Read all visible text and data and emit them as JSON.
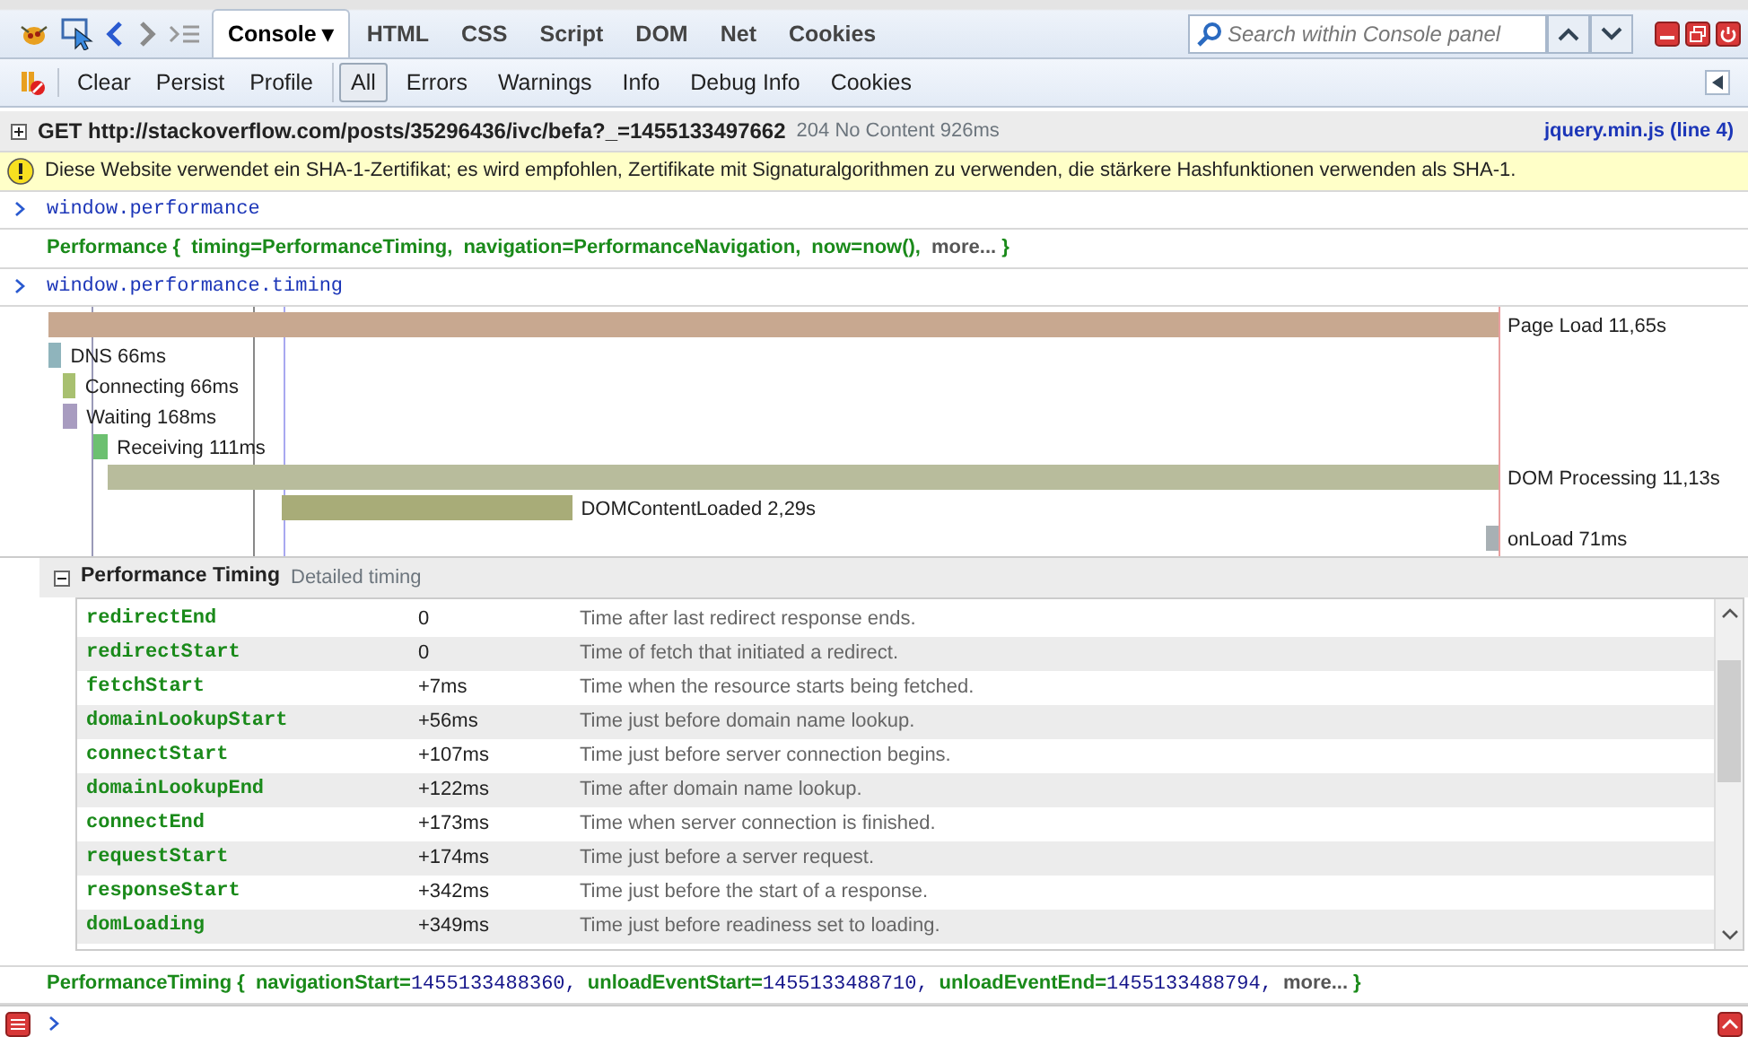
{
  "tabs": [
    {
      "label": "Console",
      "selected": true,
      "dropdown": "▾"
    },
    {
      "label": "HTML",
      "selected": false
    },
    {
      "label": "CSS",
      "selected": false
    },
    {
      "label": "Script",
      "selected": false
    },
    {
      "label": "DOM",
      "selected": false
    },
    {
      "label": "Net",
      "selected": false
    },
    {
      "label": "Cookies",
      "selected": false
    }
  ],
  "search": {
    "placeholder": "Search within Console panel"
  },
  "actions": [
    "Clear",
    "Persist",
    "Profile"
  ],
  "filters": [
    {
      "label": "All",
      "selected": true
    },
    {
      "label": "Errors",
      "selected": false
    },
    {
      "label": "Warnings",
      "selected": false
    },
    {
      "label": "Info",
      "selected": false
    },
    {
      "label": "Debug Info",
      "selected": false
    },
    {
      "label": "Cookies",
      "selected": false
    }
  ],
  "log": [
    {
      "kind": "request",
      "text": "GET http://stackoverflow.com/posts/35296436/ivc/befa?_=1455133497662",
      "status": "204 No Content 926ms",
      "source": "jquery.min.js (line 4)"
    },
    {
      "kind": "warning",
      "text": "Diese Website verwendet ein SHA-1-Zertifikat; es wird empfohlen, Zertifikate mit Signaturalgorithmen zu verwenden, die stärkere Hashfunktionen verwenden als SHA-1."
    },
    {
      "kind": "command",
      "text": "window.performance"
    },
    {
      "kind": "result",
      "object": "Performance",
      "open": "{",
      "props": [
        {
          "name": "timing=",
          "value": "PerformanceTiming,",
          "kind": "object"
        },
        {
          "name": "navigation=",
          "value": "PerformanceNavigation,",
          "kind": "object"
        },
        {
          "name": "now=",
          "value": "now(),",
          "kind": "object"
        }
      ],
      "more": "more...",
      "close": "}"
    },
    {
      "kind": "command",
      "text": "window.performance.timing"
    }
  ],
  "timeline": [
    {
      "label": "Page Load 11,65s",
      "color": "#c8a890"
    },
    {
      "label": "DNS 66ms",
      "color": "#8fb4bc"
    },
    {
      "label": "Connecting 66ms",
      "color": "#a8c070"
    },
    {
      "label": "Waiting 168ms",
      "color": "#a89cc0"
    },
    {
      "label": "Receiving 111ms",
      "color": "#6cc070"
    },
    {
      "label": "DOM Processing 11,13s",
      "color": "#b8bc9c"
    },
    {
      "label": "DOMContentLoaded 2,29s",
      "color": "#a8ac78"
    },
    {
      "label": "onLoad 71ms",
      "color": "#a8b0b4"
    }
  ],
  "timing_panel": {
    "expanded": true,
    "title": "Performance Timing",
    "subtitle": "Detailed timing",
    "rows": [
      {
        "name": "redirectEnd",
        "value": "0",
        "description": "Time after last redirect response ends."
      },
      {
        "name": "redirectStart",
        "value": "0",
        "description": "Time of fetch that initiated a redirect."
      },
      {
        "name": "fetchStart",
        "value": "+7ms",
        "description": "Time when the resource starts being fetched."
      },
      {
        "name": "domainLookupStart",
        "value": "+56ms",
        "description": "Time just before domain name lookup."
      },
      {
        "name": "connectStart",
        "value": "+107ms",
        "description": "Time just before server connection begins."
      },
      {
        "name": "domainLookupEnd",
        "value": "+122ms",
        "description": "Time after domain name lookup."
      },
      {
        "name": "connectEnd",
        "value": "+173ms",
        "description": "Time when server connection is finished."
      },
      {
        "name": "requestStart",
        "value": "+174ms",
        "description": "Time just before a server request."
      },
      {
        "name": "responseStart",
        "value": "+342ms",
        "description": "Time just before the start of a response."
      },
      {
        "name": "domLoading",
        "value": "+349ms",
        "description": "Time just before readiness set to loading."
      }
    ]
  },
  "final_result": {
    "object": "PerformanceTiming",
    "open": "{",
    "props": [
      {
        "name": "navigationStart=",
        "value": "1455133488360,",
        "kind": "number"
      },
      {
        "name": "unloadEventStart=",
        "value": "1455133488710,",
        "kind": "number"
      },
      {
        "name": "unloadEventEnd=",
        "value": "1455133488794,",
        "kind": "number"
      }
    ],
    "more": "more...",
    "close": "}"
  }
}
